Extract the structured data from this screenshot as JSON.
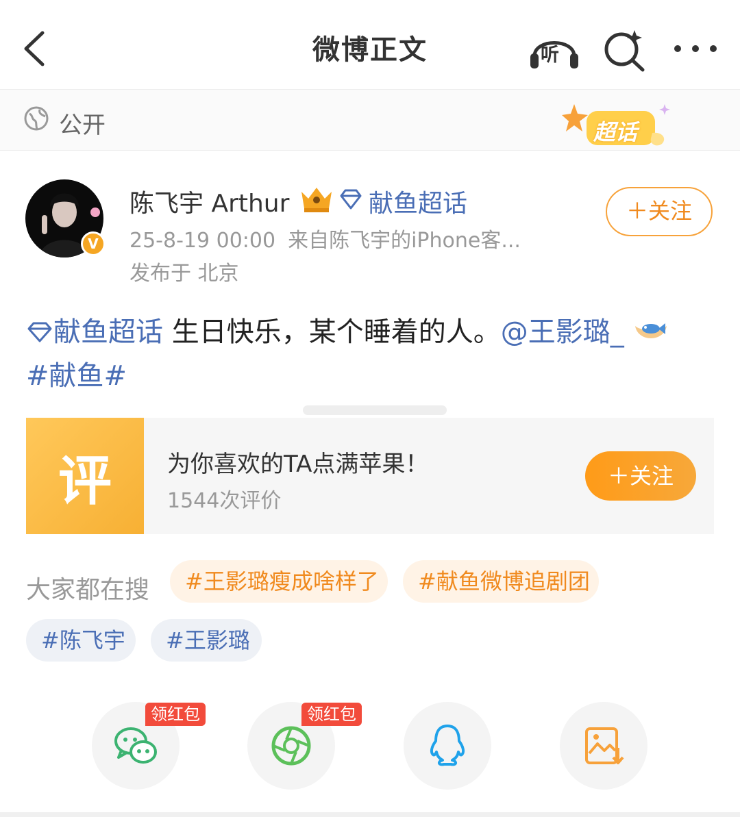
{
  "header": {
    "title": "微博正文",
    "listen_label": "听"
  },
  "visibility": {
    "label": "公开",
    "badge": "超话"
  },
  "author": {
    "name": "陈飞宇 Arthur",
    "super_topic": "献鱼超话",
    "time": "25-8-19 00:00",
    "source": "来自陈飞宇的iPhone客...",
    "location": "发布于 北京",
    "follow_label": "＋关注",
    "verified_mark": "V"
  },
  "post": {
    "topic": "献鱼超话",
    "text": " 生日快乐，某个睡着的人。",
    "mention": "@王影璐_",
    "hashtag": "#献鱼#"
  },
  "card": {
    "image_char": "评",
    "title": "为你喜欢的TA点满苹果！",
    "subtitle": "1544次评价",
    "follow_label": "＋关注"
  },
  "searches": {
    "label": "大家都在搜",
    "chips": [
      "#王影璐瘦成啥样了",
      "#献鱼微博追剧团",
      "#陈飞宇",
      "#王影璐"
    ]
  },
  "share": {
    "tag": "领红包",
    "items": [
      "wechat-icon",
      "moments-icon",
      "qq-icon",
      "save-image-icon"
    ]
  },
  "colors": {
    "accent_orange": "#f08a1e",
    "link_blue": "#4a6eb5",
    "red_tag": "#f24b3b"
  }
}
